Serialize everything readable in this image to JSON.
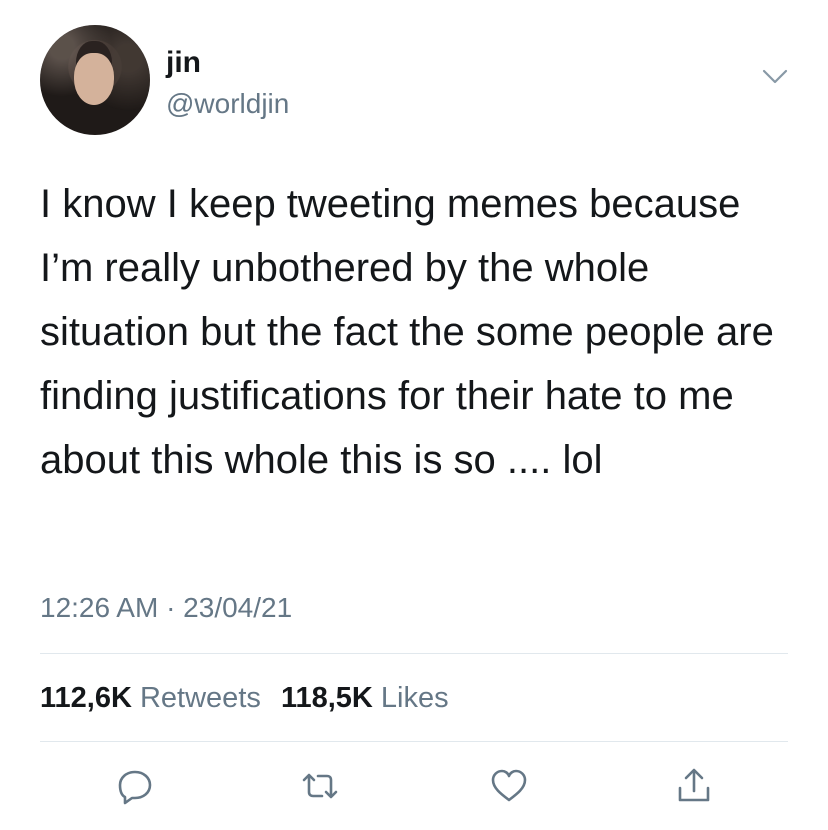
{
  "tweet": {
    "display_name": "jin",
    "handle": "@worldjin",
    "text": "I know I keep tweeting memes because I’m really unbothered by the whole situation but the fact the some people are finding justifications for their hate to me about this whole this is so .... lol",
    "timestamp": "12:26 AM · 23/04/21",
    "retweets_count": "112,6K",
    "retweets_label": "Retweets",
    "likes_count": "118,5K",
    "likes_label": "Likes"
  },
  "icons": {
    "menu": "chevron-down-icon",
    "reply": "reply-icon",
    "retweet": "retweet-icon",
    "like": "heart-icon",
    "share": "share-icon"
  },
  "colors": {
    "text": "#14171a",
    "secondary": "#657786",
    "divider": "#e1e8ed"
  }
}
